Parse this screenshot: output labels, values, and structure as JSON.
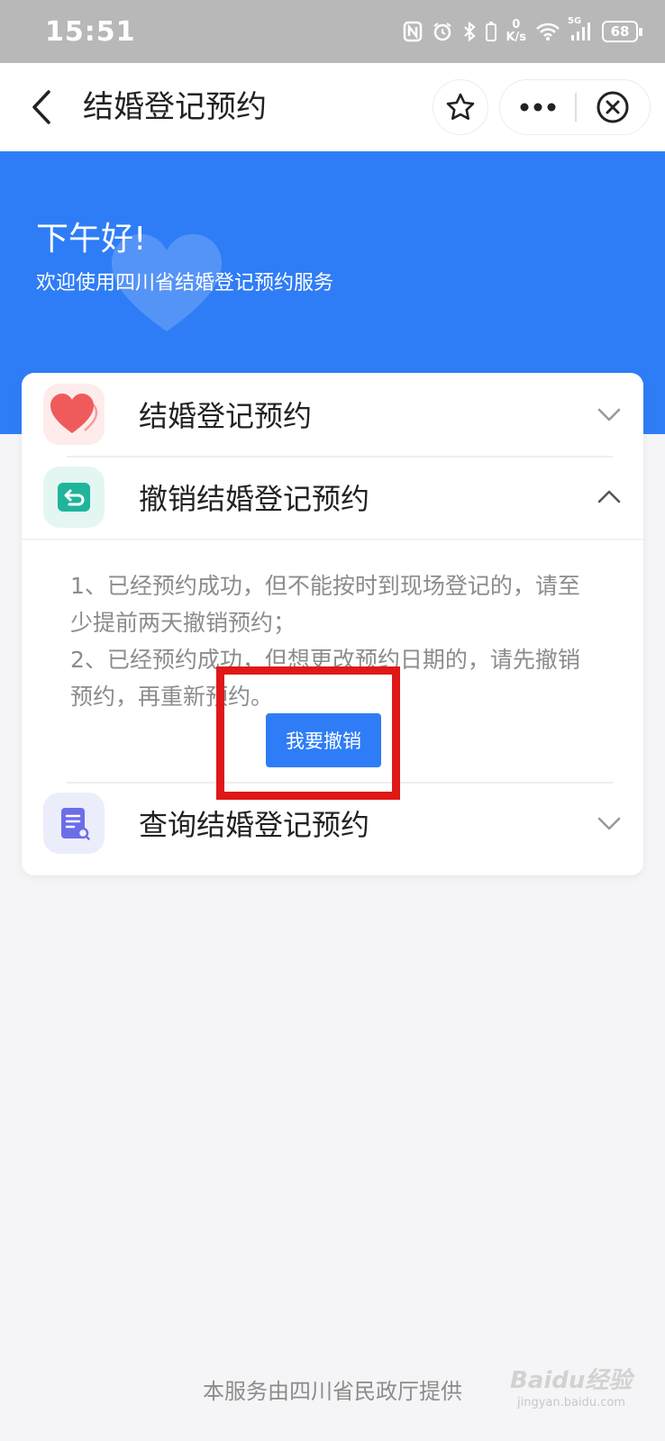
{
  "status_bar": {
    "time": "15:51",
    "net_speed_value": "0",
    "net_speed_unit": "K/s",
    "signal_label": "5G",
    "battery": "68"
  },
  "nav": {
    "title": "结婚登记预约",
    "icons": [
      "back-icon",
      "star-icon",
      "more-icon",
      "close-icon"
    ]
  },
  "hero": {
    "greeting": "下午好!",
    "welcome": "欢迎使用四川省结婚登记预约服务"
  },
  "card": {
    "items": [
      {
        "label": "结婚登记预约",
        "icon": "heart-icon",
        "expanded": false
      },
      {
        "label": "撤销结婚登记预约",
        "icon": "undo-icon",
        "expanded": true
      },
      {
        "label": "查询结婚登记预约",
        "icon": "search-doc-icon",
        "expanded": false
      }
    ],
    "cancel_desc": {
      "line1": "1、已经预约成功，但不能按时到现场登记的，请至少提前两天撤销预约；",
      "line2": "2、已经预约成功，但想更改预约日期的，请先撤销预约，再重新预约。"
    },
    "cancel_button": "我要撤销"
  },
  "footer": {
    "text": "本服务由四川省民政厅提供"
  },
  "watermark": {
    "text": "Baidu经验",
    "sub": "jingyan.baidu.com"
  },
  "colors": {
    "brand_blue": "#2f7df6",
    "highlight_red": "#e01818",
    "heart_red": "#ef5b5b",
    "undo_teal": "#1fb59b",
    "query_purple": "#6b6ee8"
  }
}
